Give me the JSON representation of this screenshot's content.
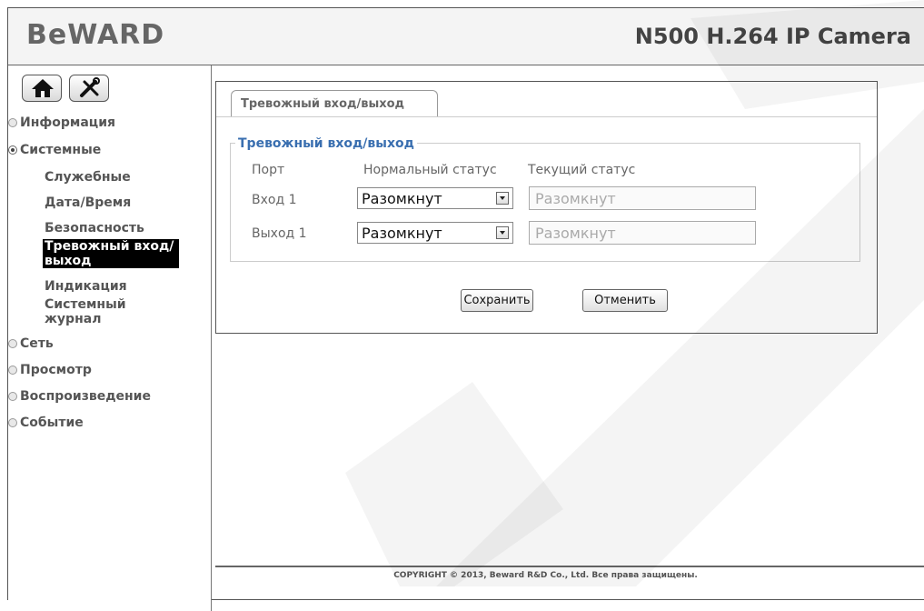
{
  "header": {
    "logo": "BeWARD",
    "camera_title": "N500 H.264 IP Camera"
  },
  "toolbar": {
    "home_icon": "home-icon",
    "settings_icon": "tools-icon"
  },
  "sidebar": {
    "items": [
      {
        "label": "Информация",
        "selected": false
      },
      {
        "label": "Системные",
        "selected": true
      },
      {
        "label": "Сеть",
        "selected": false
      },
      {
        "label": "Просмотр",
        "selected": false
      },
      {
        "label": "Воспроизведение",
        "selected": false
      },
      {
        "label": "Событие",
        "selected": false
      }
    ],
    "subitems": [
      {
        "label": "Служебные"
      },
      {
        "label": "Дата/Время"
      },
      {
        "label": "Безопасность"
      },
      {
        "label": "Тревожный вход/выход",
        "active": true
      },
      {
        "label": "Индикация"
      },
      {
        "label": "Системный журнал"
      }
    ]
  },
  "main": {
    "tab_label": "Тревожный вход/выход",
    "fieldset_legend": "Тревожный вход/выход",
    "columns": {
      "port": "Порт",
      "normal_status": "Нормальный статус",
      "current_status": "Текущий статус"
    },
    "rows": [
      {
        "port": "Вход 1",
        "normal": "Разомкнут",
        "current": "Разомкнут"
      },
      {
        "port": "Выход 1",
        "normal": "Разомкнут",
        "current": "Разомкнут"
      }
    ],
    "save_label": "Сохранить",
    "cancel_label": "Отменить"
  },
  "footer": {
    "copyright": "COPYRIGHT © 2013, Beward R&D Co., Ltd. Все права защищены."
  },
  "colors": {
    "legend": "#3a6fb0",
    "active_menu_bg": "#000000"
  }
}
